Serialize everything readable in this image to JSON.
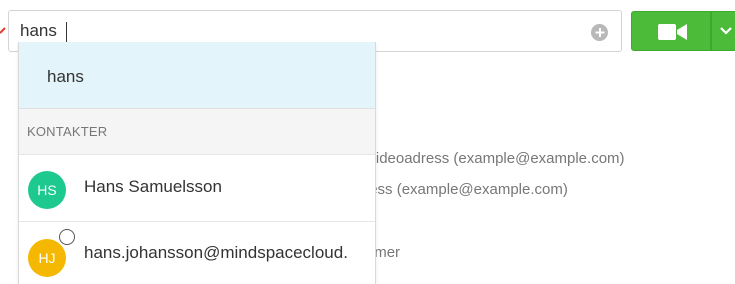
{
  "search": {
    "value": "hans",
    "clear_icon": "clear-circle-icon"
  },
  "call_button": {
    "icon": "video-camera-icon",
    "dropdown_icon": "chevron-down-icon",
    "color": "#4cbb3a"
  },
  "background_text": {
    "line1": "samtalets videoadress (example@example.com)",
    "line2": "s videoadress (example@example.com)",
    "line3": "telefonnummer"
  },
  "dropdown": {
    "suggestion": "hans",
    "section_header": "KONTAKTER",
    "contacts": [
      {
        "initials": "HS",
        "name": "Hans Samuelsson",
        "avatar_color": "#1dc98f"
      },
      {
        "initials": "HJ",
        "name": "hans.johansson@mindspacecloud.",
        "avatar_color": "#f5b800"
      }
    ]
  }
}
